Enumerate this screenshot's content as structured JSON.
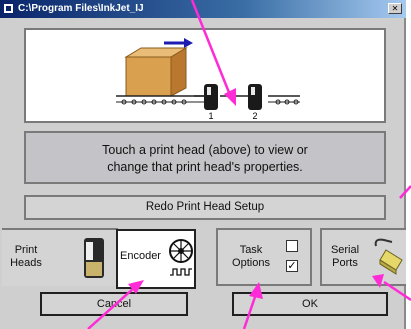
{
  "window": {
    "title": "C:\\Program Files\\InkJet_IJ",
    "close_glyph": "✕"
  },
  "scene": {
    "head_labels": [
      "1",
      "2"
    ]
  },
  "message": {
    "line1": "Touch a print head (above) to view or",
    "line2": "change that print head's properties."
  },
  "redo_button": {
    "label": "Redo Print Head Setup"
  },
  "tabs": [
    {
      "id": "print-heads",
      "line1": "Print",
      "line2": "Heads",
      "icon": "print-head-icon"
    },
    {
      "id": "encoder",
      "label": "Encoder",
      "icon": "encoder-wheel-icon"
    },
    {
      "id": "task-options",
      "line1": "Task",
      "line2": "Options",
      "icon": "checkbox-icon",
      "checkbox_unchecked": "",
      "checkbox_checked": "✓"
    },
    {
      "id": "serial-ports",
      "line1": "Serial",
      "line2": "Ports",
      "icon": "serial-cable-icon"
    }
  ],
  "buttons": {
    "cancel": "Cancel",
    "ok": "OK"
  },
  "colors": {
    "arrow": "#ff2bd6",
    "box": "#d9a14f",
    "direction_arrow": "#1c1cb0"
  }
}
